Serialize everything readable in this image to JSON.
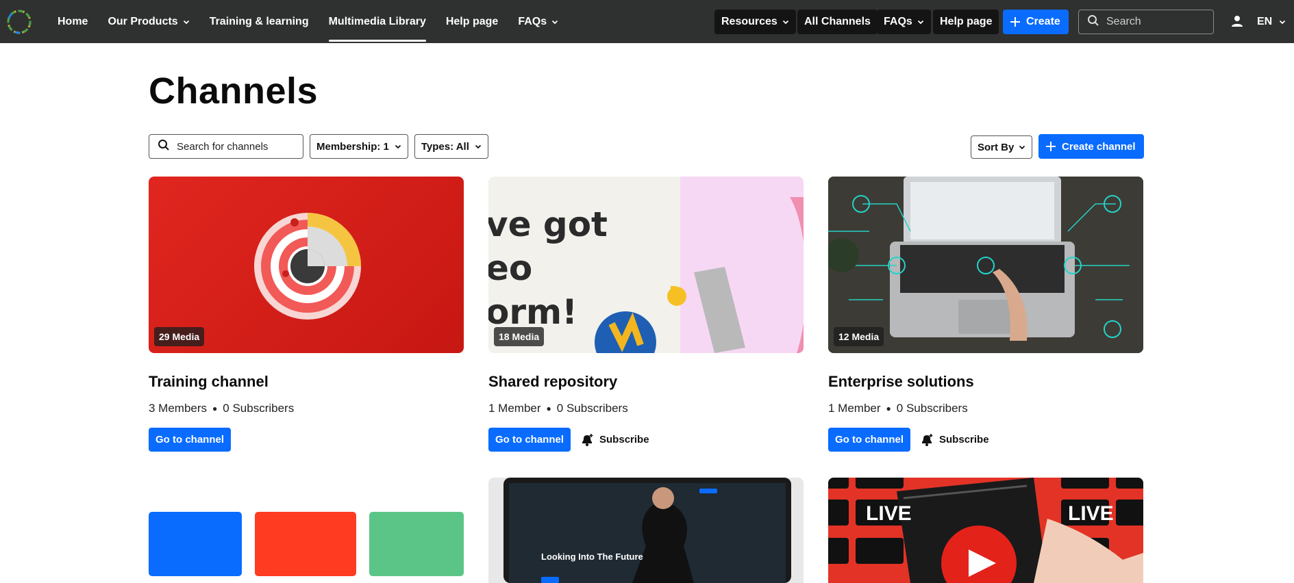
{
  "nav": {
    "items": [
      {
        "label": "Home",
        "has_caret": false,
        "active": false
      },
      {
        "label": "Our Products",
        "has_caret": true,
        "active": false
      },
      {
        "label": "Training & learning",
        "has_caret": false,
        "active": false
      },
      {
        "label": "Multimedia Library",
        "has_caret": false,
        "active": true
      },
      {
        "label": "Help page",
        "has_caret": false,
        "active": false
      },
      {
        "label": "FAQs",
        "has_caret": true,
        "active": false
      }
    ]
  },
  "toolbar": {
    "resources_label": "Resources",
    "all_channels_label": "All Channels",
    "faqs_label": "FAQs",
    "help_label": "Help page",
    "create_label": "Create",
    "search_placeholder": "Search",
    "language": "EN"
  },
  "page": {
    "title": "Channels",
    "search_placeholder": "Search for channels",
    "membership_filter": "Membership: 1",
    "types_filter": "Types: All",
    "sort_label": "Sort By",
    "create_channel_label": "Create channel"
  },
  "channels": [
    {
      "name": "Training channel",
      "media": "29 Media",
      "members": "3 Members",
      "subscribers": "0 Subscribers",
      "go_label": "Go to channel",
      "subscribe_label": ""
    },
    {
      "name": "Shared repository",
      "media": "18 Media",
      "members": "1 Member",
      "subscribers": "0 Subscribers",
      "go_label": "Go to channel",
      "subscribe_label": "Subscribe",
      "thumb_text": [
        "ve got",
        "eo",
        "orm!"
      ]
    },
    {
      "name": "Enterprise solutions",
      "media": "12 Media",
      "members": "1 Member",
      "subscribers": "0 Subscribers",
      "go_label": "Go to channel",
      "subscribe_label": "Subscribe"
    }
  ],
  "second_row": {
    "video_title": "Looking Into The Future",
    "live_text": "LIVE"
  },
  "colors": {
    "topbar": "#2f3030",
    "accent": "#0a6cff",
    "pill": "#141414"
  },
  "icons": [
    "logo-icon",
    "chevron-down-icon",
    "plus-icon",
    "search-icon",
    "user-icon",
    "bell-plus-icon"
  ]
}
